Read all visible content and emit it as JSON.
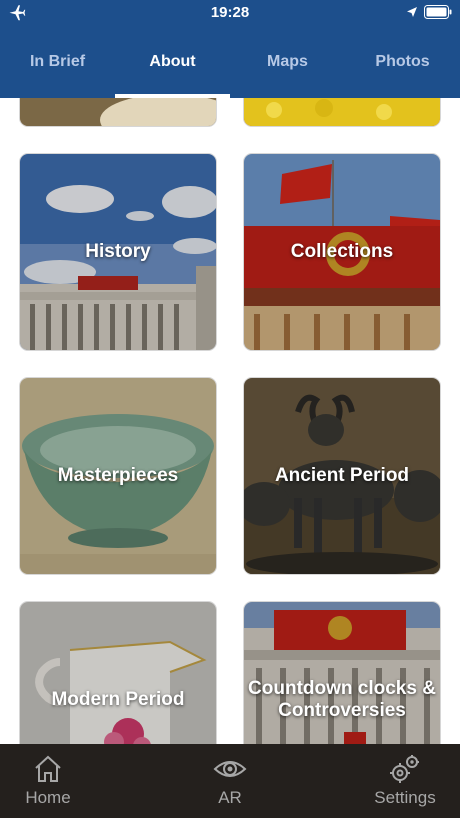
{
  "status_bar": {
    "time": "19:28"
  },
  "tabs": [
    {
      "label": "In Brief"
    },
    {
      "label": "About",
      "active": true
    },
    {
      "label": "Maps"
    },
    {
      "label": "Photos"
    }
  ],
  "cards": [
    {
      "title": "History",
      "icon": "museum-facade-photo"
    },
    {
      "title": "Collections",
      "icon": "red-facade-flag-photo"
    },
    {
      "title": "Masterpieces",
      "icon": "jade-bowl-photo"
    },
    {
      "title": "Ancient Period",
      "icon": "bronze-ox-photo"
    },
    {
      "title": "Modern Period",
      "icon": "porcelain-pitcher-photo"
    },
    {
      "title": "Countdown clocks & Controversies",
      "icon": "building-facade-photo"
    }
  ],
  "bottom_nav": [
    {
      "label": "Home",
      "icon": "home-icon"
    },
    {
      "label": "AR",
      "icon": "eye-icon"
    },
    {
      "label": "Settings",
      "icon": "gears-icon"
    }
  ],
  "colors": {
    "header_blue": "#1d4f8c",
    "bottom_bar": "#24201d",
    "inactive_tab": "#b7c9e6",
    "bottom_text": "#a7a7a7"
  }
}
